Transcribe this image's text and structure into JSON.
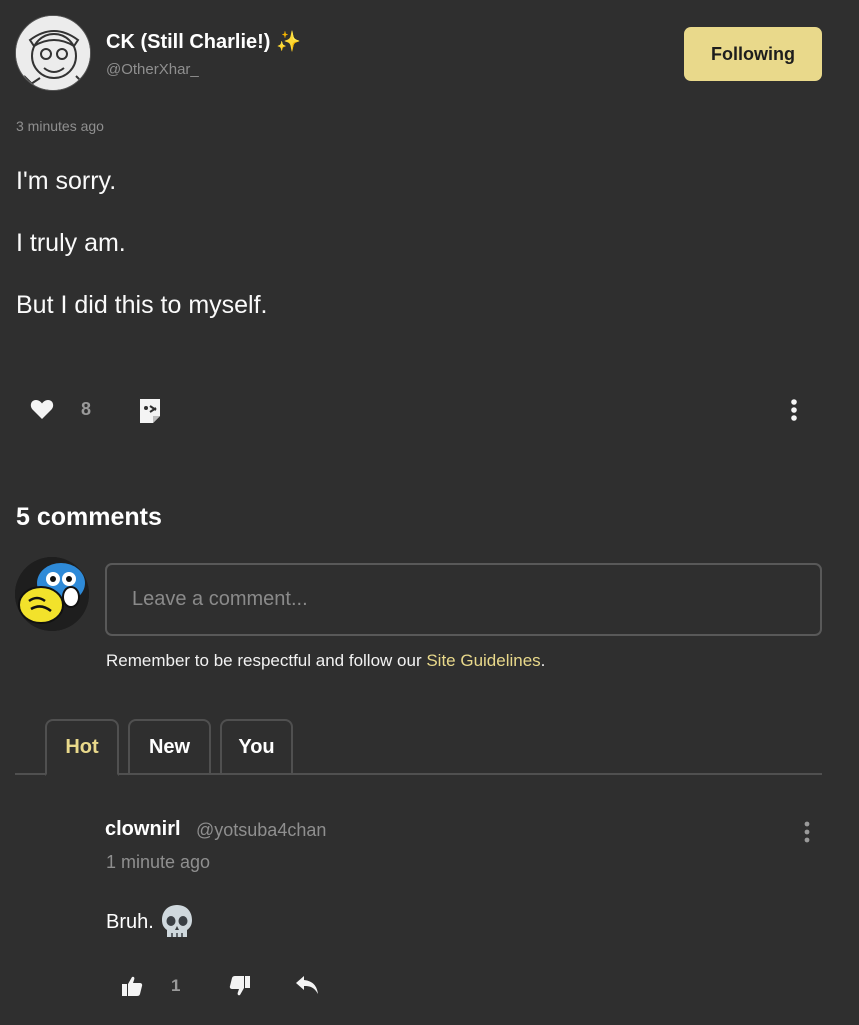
{
  "post": {
    "author_name": "CK (Still Charlie!) ✨",
    "author_handle": "@OtherXhar_",
    "follow_label": "Following",
    "timestamp": "3 minutes ago",
    "paragraphs": [
      "I'm sorry.",
      "I truly am.",
      "But I did this to myself."
    ],
    "like_count": "8"
  },
  "comments_section": {
    "title": "5 comments",
    "input_placeholder": "Leave a comment...",
    "guidelines_prefix": "Remember to be respectful and follow our ",
    "guidelines_link": "Site Guidelines",
    "guidelines_suffix": ".",
    "tabs": [
      {
        "label": "Hot",
        "active": true
      },
      {
        "label": "New",
        "active": false
      },
      {
        "label": "You",
        "active": false
      }
    ]
  },
  "comments": [
    {
      "author": "clownirl",
      "handle": "@yotsuba4chan",
      "time": "1 minute ago",
      "text": "Bruh.",
      "upvotes": "1"
    }
  ],
  "colors": {
    "background": "#2f2f2f",
    "accent": "#e9d98b",
    "muted_text": "#8f8f8f",
    "border": "#505050"
  },
  "icons": [
    "heart-icon",
    "share-icon",
    "more-vertical-icon",
    "skull-emoji-icon",
    "thumbs-up-icon",
    "thumbs-down-icon",
    "reply-icon"
  ]
}
